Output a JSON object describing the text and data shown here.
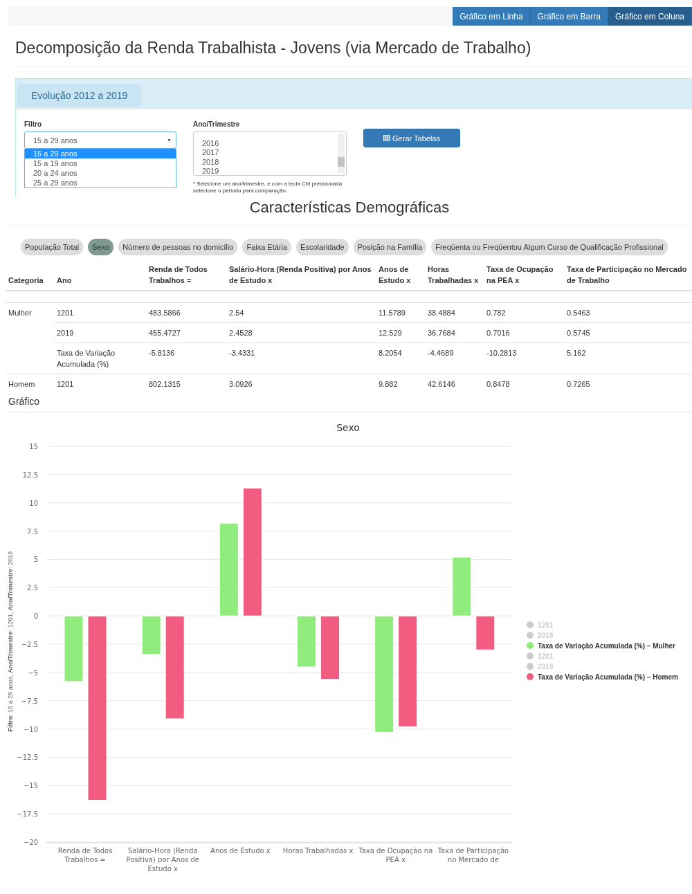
{
  "chart_type_buttons": [
    {
      "label": "Gráfico em Linha",
      "selected": false
    },
    {
      "label": "Gráfico em Barra",
      "selected": false
    },
    {
      "label": "Gráfico em Coluna",
      "selected": true
    }
  ],
  "title": "Decomposição da Renda Trabalhista - Jovens (via Mercado de Trabalho)",
  "panel": {
    "tab": "Evolução 2012 a 2019",
    "filter": {
      "label": "Filtro",
      "value": "15 a 29 anos",
      "caret": "▼",
      "options": [
        {
          "label": "15 a 29 anos",
          "selected": true
        },
        {
          "label": "15 a 19 anos",
          "selected": false
        },
        {
          "label": "20 a 24 anos",
          "selected": false
        },
        {
          "label": "25 a 29 anos",
          "selected": false
        }
      ]
    },
    "period": {
      "label": "Ano/Trimestre",
      "options": [
        {
          "label": "2016",
          "selected": false
        },
        {
          "label": "2017",
          "selected": false
        },
        {
          "label": "2018",
          "selected": false
        },
        {
          "label": "2019",
          "selected": false
        }
      ],
      "hint": "* Selecione um ano/trimestre, e com a tecla Ctrl pressionada selecione o periodo para comparação."
    },
    "button": "Gerar Tabelas"
  },
  "section_title": "Características Demográficas",
  "pills": [
    {
      "label": "População Total",
      "selected": false
    },
    {
      "label": "Sexo",
      "selected": true
    },
    {
      "label": "Número de pessoas no domicílio",
      "selected": false
    },
    {
      "label": "Faixa Etária",
      "selected": false
    },
    {
      "label": "Escolaridade",
      "selected": false
    },
    {
      "label": "Posição na Família",
      "selected": false
    },
    {
      "label": "Freqüenta ou Freqüentou Algum Curso de Qualificação Profissional",
      "selected": false
    }
  ],
  "table": {
    "columns": [
      "Categoria",
      "Ano",
      "Renda de Todos Trabalhos =",
      "Salário-Hora (Renda Positiva) por Anos de Estudo x",
      "Anos de Estudo x",
      "Horas Trabalhadas x",
      "Taxa de Ocupação na PEA x",
      "Taxa de Participação no Mercado de Trabalho"
    ],
    "groups": [
      {
        "category": "Mulher",
        "rows": [
          [
            "1201",
            "483.5866",
            "2.54",
            "11.5789",
            "38.4884",
            "0.782",
            "0.5463"
          ],
          [
            "2019",
            "455.4727",
            "2.4528",
            "12.529",
            "36.7684",
            "0.7016",
            "0.5745"
          ],
          [
            "Taxa de Variação Acumulada (%)",
            "-5.8136",
            "-3.4331",
            "8.2054",
            "-4.4689",
            "-10.2813",
            "5.162"
          ]
        ]
      },
      {
        "category": "Homem",
        "rows": [
          [
            "1201",
            "802.1315",
            "3.0926",
            "9.882",
            "42.6146",
            "0.8478",
            "0.7265"
          ]
        ]
      }
    ]
  },
  "chart_heading": "Gráfico",
  "chart_data": {
    "type": "bar",
    "title": "Sexo",
    "ylabel": "**Filtro**: 15 a 29 anos, **Ano/Trimestre**: 1201, **Ano/Trimestre**: 2019",
    "categories": [
      "Renda de Todos Trabalhos =",
      "Salário-Hora (Renda Positiva) por Anos de Estudo x",
      "Anos de Estudo x",
      "Horas Trabalhadas x",
      "Taxa de Ocupação na PEA x",
      "Taxa de Participação no Mercado de"
    ],
    "grid": true,
    "legend": true,
    "series": [
      {
        "name": "Taxa de Variação Acumulada (%) – Mulher",
        "color": "#90ed7d",
        "values": [
          -5.8,
          -3.4,
          8.2,
          -4.5,
          -10.3,
          5.2
        ]
      },
      {
        "name": "Taxa de Variação Acumulada (%) – Homem",
        "color": "#f15c80",
        "values": [
          -16.3,
          -9.1,
          11.3,
          -5.6,
          -9.8,
          -3.0
        ]
      }
    ],
    "ylim": [
      -20,
      15
    ],
    "yticks": [
      {
        "value": 15,
        "label": "15"
      },
      {
        "value": 12.5,
        "label": "12.5"
      },
      {
        "value": 10,
        "label": "10"
      },
      {
        "value": 7.5,
        "label": "7.5"
      },
      {
        "value": 5,
        "label": "5"
      },
      {
        "value": 2.5,
        "label": "2.5"
      },
      {
        "value": 0,
        "label": "0"
      },
      {
        "value": -2.5,
        "label": "−2.5"
      },
      {
        "value": -5,
        "label": "−5"
      },
      {
        "value": -7.5,
        "label": "−7.5"
      },
      {
        "value": -10,
        "label": "−10"
      },
      {
        "value": -12.5,
        "label": "−12.5"
      },
      {
        "value": -15,
        "label": "−15"
      },
      {
        "value": -17.5,
        "label": "−17.5"
      },
      {
        "value": -20,
        "label": "−20"
      }
    ]
  },
  "hidden_legend_entries": [
    [
      "1201",
      "2019"
    ],
    [
      "1201",
      "2019"
    ]
  ]
}
